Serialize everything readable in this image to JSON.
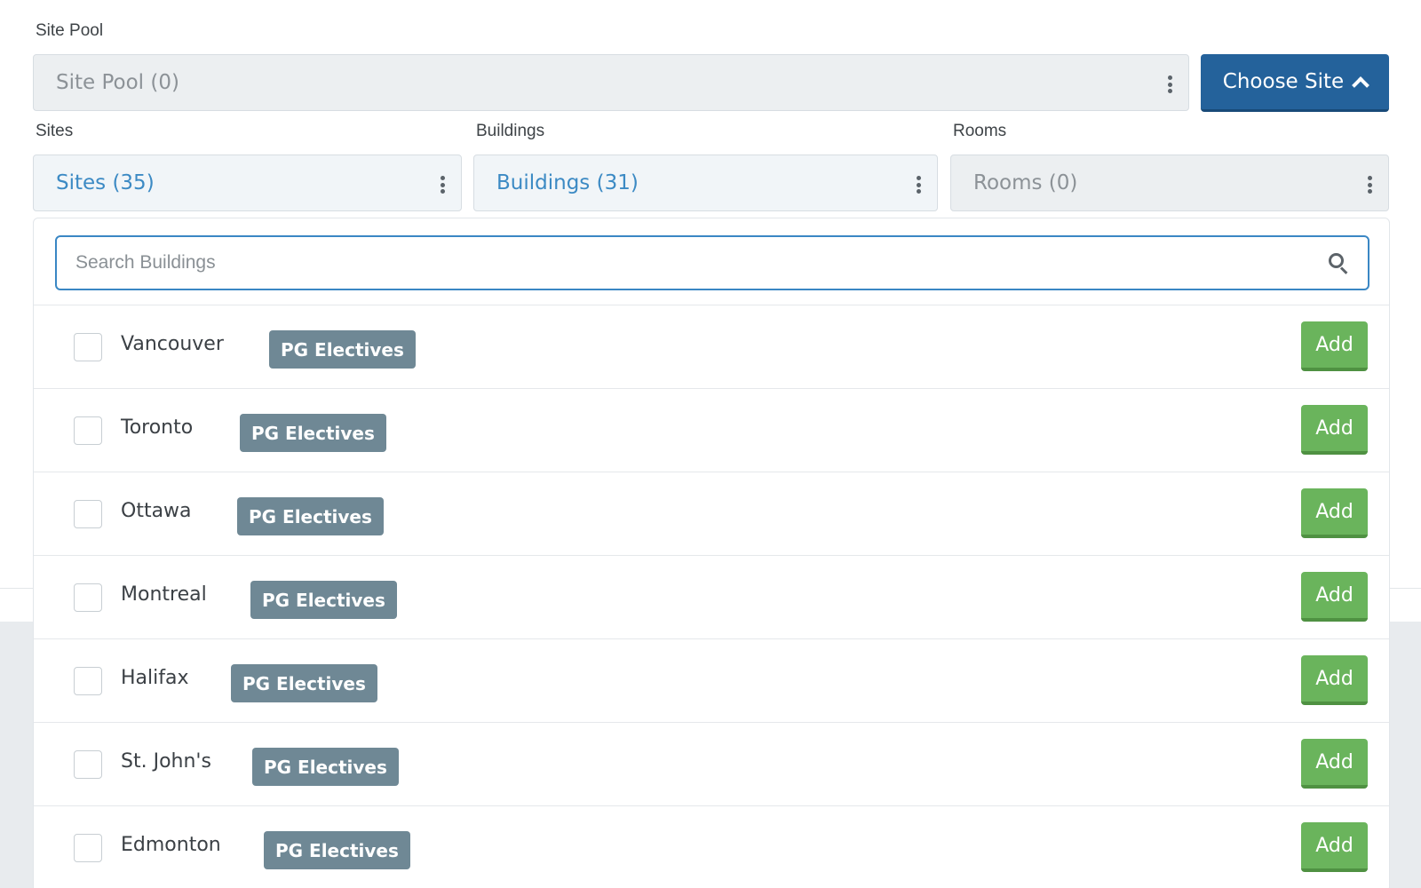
{
  "site_pool": {
    "label": "Site Pool",
    "value": "Site Pool (0)",
    "choose_button": "Choose Site"
  },
  "sites": {
    "label": "Sites",
    "value": "Sites (35)"
  },
  "buildings": {
    "label": "Buildings",
    "value": "Buildings (31)"
  },
  "rooms": {
    "label": "Rooms",
    "value": "Rooms (0)"
  },
  "dropdown": {
    "search_placeholder": "Search Buildings",
    "items": [
      {
        "name": "Vancouver",
        "tag": "PG Electives",
        "action": "Add"
      },
      {
        "name": "Toronto",
        "tag": "PG Electives",
        "action": "Add"
      },
      {
        "name": "Ottawa",
        "tag": "PG Electives",
        "action": "Add"
      },
      {
        "name": "Montreal",
        "tag": "PG Electives",
        "action": "Add"
      },
      {
        "name": "Halifax",
        "tag": "PG Electives",
        "action": "Add"
      },
      {
        "name": "St. John's",
        "tag": "PG Electives",
        "action": "Add"
      },
      {
        "name": "Edmonton",
        "tag": "PG Electives",
        "action": "Add"
      }
    ]
  },
  "colors": {
    "primary": "#24629b",
    "link": "#3c8ac4",
    "add_green": "#6ab45c",
    "tag_gray": "#6f8895"
  }
}
